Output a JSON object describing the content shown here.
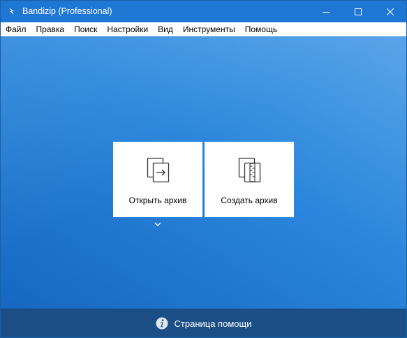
{
  "window": {
    "title": "Bandizip (Professional)",
    "controls": {
      "minimize_icon": "minimize-icon",
      "maximize_icon": "maximize-icon",
      "close_icon": "close-icon"
    }
  },
  "menu": {
    "items": [
      {
        "label": "Файл"
      },
      {
        "label": "Правка"
      },
      {
        "label": "Поиск"
      },
      {
        "label": "Настройки"
      },
      {
        "label": "Вид"
      },
      {
        "label": "Инструменты"
      },
      {
        "label": "Помощь"
      }
    ]
  },
  "main": {
    "open_tile": {
      "label": "Открыть архив",
      "icon": "open-archive-icon"
    },
    "create_tile": {
      "label": "Создать архив",
      "icon": "create-archive-icon"
    },
    "dropdown_icon": "chevron-down-icon"
  },
  "footer": {
    "help_label": "Страница помощи",
    "icon": "info-icon"
  },
  "colors": {
    "titlebar": "#1f77d4",
    "background_accent": "#2a86dc",
    "footer": "#1c4f86",
    "tile": "#ffffff"
  }
}
